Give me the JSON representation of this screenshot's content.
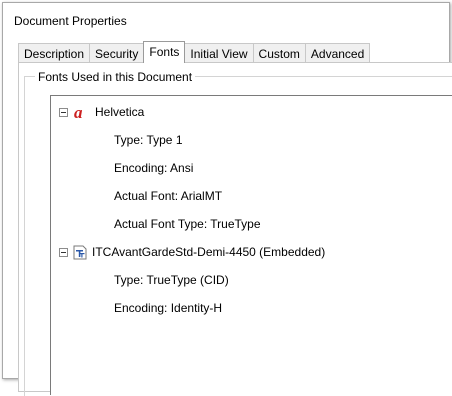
{
  "window": {
    "title": "Document Properties"
  },
  "tabs": [
    {
      "label": "Description",
      "active": false
    },
    {
      "label": "Security",
      "active": false
    },
    {
      "label": "Fonts",
      "active": true
    },
    {
      "label": "Initial View",
      "active": false
    },
    {
      "label": "Custom",
      "active": false
    },
    {
      "label": "Advanced",
      "active": false
    }
  ],
  "fonts_group": {
    "label": "Fonts Used in this Document"
  },
  "fonts": [
    {
      "name": "Helvetica",
      "icon": "type1-font-icon",
      "details": {
        "type": "Type: Type 1",
        "encoding": "Encoding: Ansi",
        "actual_font": "Actual Font: ArialMT",
        "actual_font_type": "Actual Font Type: TrueType"
      }
    },
    {
      "name": "ITCAvantGardeStd-Demi-4450 (Embedded)",
      "icon": "truetype-font-icon",
      "details": {
        "type": "Type: TrueType (CID)",
        "encoding": "Encoding: Identity-H"
      }
    }
  ],
  "colors": {
    "type1_icon": "#cc1f1f",
    "truetype_icon": "#2a57a8"
  }
}
